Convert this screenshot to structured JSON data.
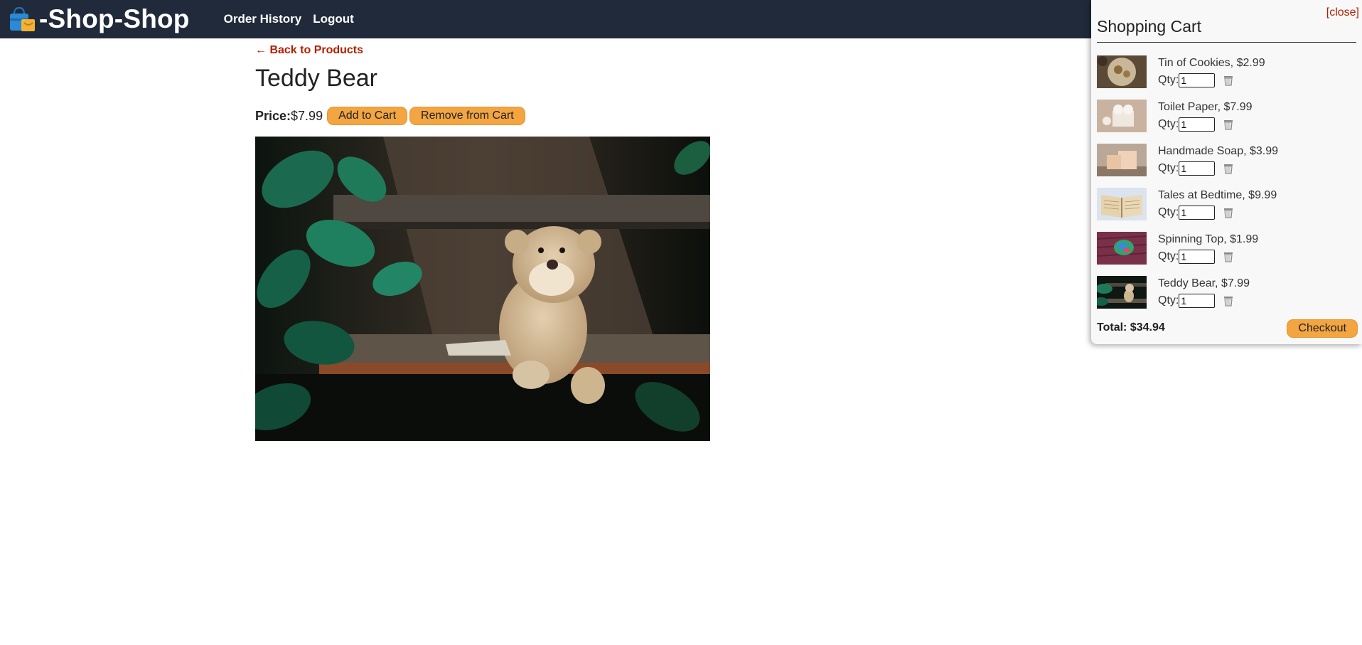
{
  "brand": {
    "title": "-Shop-Shop"
  },
  "nav": {
    "items": [
      "Order History",
      "Logout"
    ]
  },
  "product": {
    "back_label": "← Back to Products",
    "title": "Teddy Bear",
    "price_label": "Price:",
    "price_value": "$7.99",
    "add_label": "Add to Cart",
    "remove_label": "Remove from Cart"
  },
  "cart": {
    "close_label": "[close]",
    "title": "Shopping Cart",
    "qty_label": "Qty:",
    "items": [
      {
        "name": "Tin of Cookies, $2.99",
        "qty": "1"
      },
      {
        "name": "Toilet Paper, $7.99",
        "qty": "1"
      },
      {
        "name": "Handmade Soap, $3.99",
        "qty": "1"
      },
      {
        "name": "Tales at Bedtime, $9.99",
        "qty": "1"
      },
      {
        "name": "Spinning Top, $1.99",
        "qty": "1"
      },
      {
        "name": "Teddy Bear, $7.99",
        "qty": "1"
      }
    ],
    "total_label": "Total: $34.94",
    "checkout_label": "Checkout"
  },
  "icons": {
    "logo": "shopping-bag-icon",
    "delete": "trash-icon"
  },
  "colors": {
    "header_bg": "#202a3a",
    "accent": "#f2a541",
    "link_red": "#b22000"
  }
}
